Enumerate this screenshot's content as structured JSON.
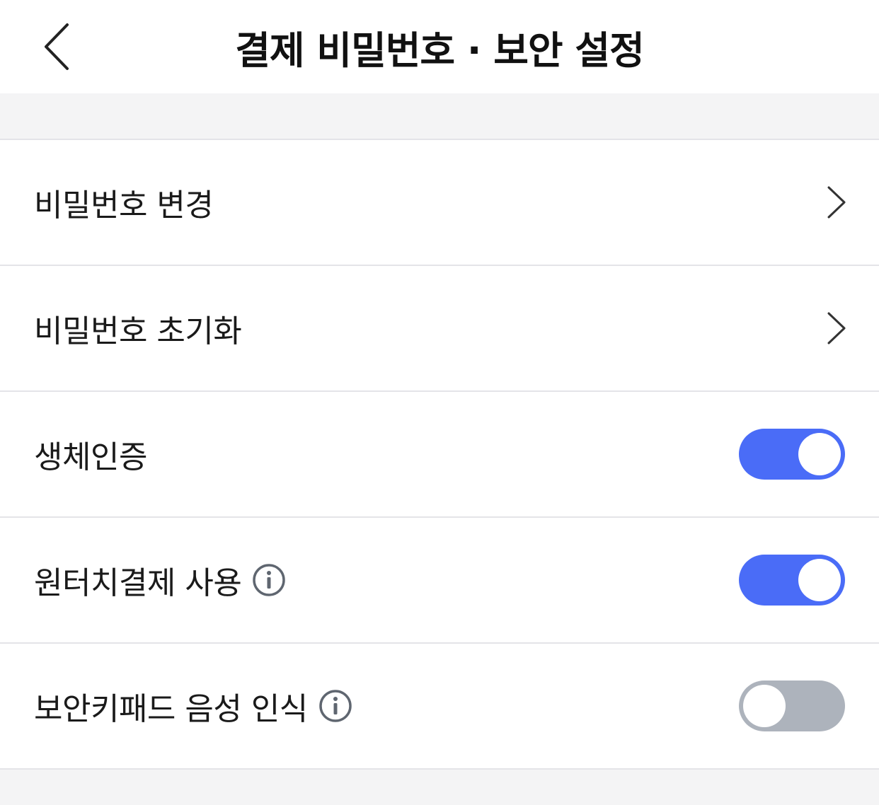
{
  "header": {
    "title": "결제 비밀번호 · 보안 설정",
    "back_icon": "chevron-left-icon"
  },
  "rows": [
    {
      "label": "비밀번호 변경",
      "control": "chevron"
    },
    {
      "label": "비밀번호 초기화",
      "control": "chevron"
    },
    {
      "label": "생체인증",
      "control": "toggle",
      "enabled": true
    },
    {
      "label": "원터치결제 사용",
      "control": "toggle",
      "enabled": true,
      "info": true
    },
    {
      "label": "보안키패드 음성 인식",
      "control": "toggle",
      "enabled": false,
      "info": true
    }
  ],
  "colors": {
    "toggle_on": "#4a6cf7",
    "toggle_off": "#adb3bc",
    "divider": "#e4e4e8",
    "background": "#f4f4f5"
  }
}
